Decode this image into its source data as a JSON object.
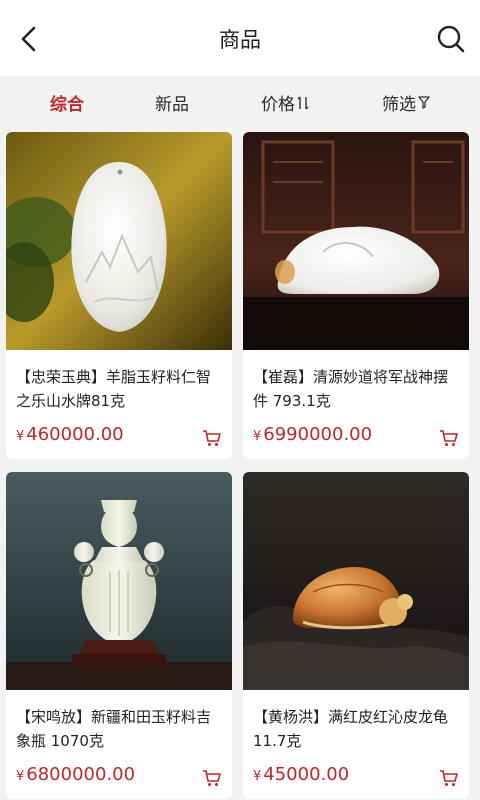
{
  "header": {
    "title": "商品",
    "back_icon": "chevron-left-icon",
    "search_icon": "search-icon"
  },
  "filters": [
    {
      "label": "综合",
      "active": true
    },
    {
      "label": "新品",
      "active": false
    },
    {
      "label": "价格",
      "icon": "sort-icon",
      "active": false
    },
    {
      "label": "筛选",
      "icon": "filter-icon",
      "active": false
    }
  ],
  "products": [
    {
      "name": "【忠荣玉典】羊脂玉籽料仁智之乐山水牌81克",
      "currency": "¥",
      "price": "460000.00"
    },
    {
      "name": "【崔磊】清源妙道将军战神摆件 793.1克",
      "currency": "¥",
      "price": "6990000.00"
    },
    {
      "name": "【宋鸣放】新疆和田玉籽料吉象瓶 1070克",
      "currency": "¥",
      "price": "6800000.00"
    },
    {
      "name": "【黄杨洪】满红皮红沁皮龙龟11.7克",
      "currency": "¥",
      "price": "45000.00"
    }
  ],
  "colors": {
    "accent": "#c0262b",
    "background": "#f2f2f2"
  }
}
